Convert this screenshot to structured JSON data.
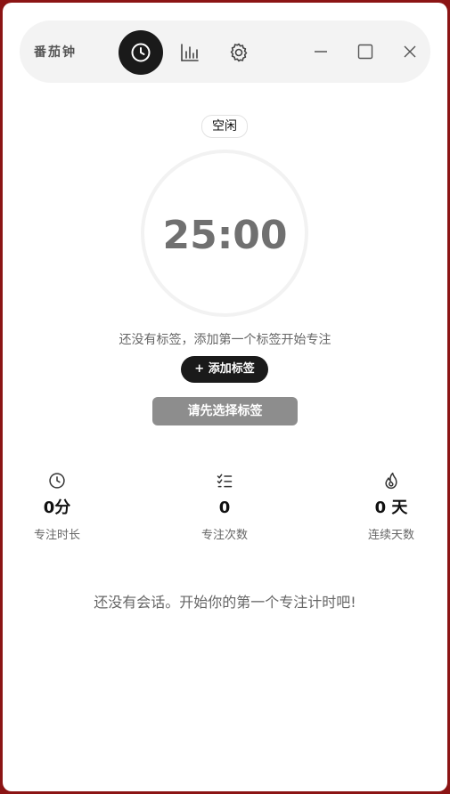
{
  "app": {
    "title": "番茄钟"
  },
  "nav": [
    {
      "name": "timer",
      "icon": "clock-icon",
      "active": true
    },
    {
      "name": "stats",
      "icon": "bar-chart-icon",
      "active": false
    },
    {
      "name": "settings",
      "icon": "gear-icon",
      "active": false
    }
  ],
  "window_controls": [
    "minimize-icon",
    "maximize-icon",
    "close-icon"
  ],
  "timer": {
    "status": "空闲",
    "time": "25:00"
  },
  "tags": {
    "hint": "还没有标签，添加第一个标签开始专注",
    "add_label": "+ 添加标签"
  },
  "start_button": {
    "label": "请先选择标签"
  },
  "stats": [
    {
      "icon": "clock-icon",
      "value": "0分",
      "label": "专注时长"
    },
    {
      "icon": "checklist-icon",
      "value": "0",
      "label": "专注次数"
    },
    {
      "icon": "flame-icon",
      "value": "0 天",
      "label": "连续天数"
    }
  ],
  "sessions": {
    "empty_text": "还没有会话。开始你的第一个专注计时吧!"
  },
  "colors": {
    "background": "#8b1414",
    "accent": "#1a1a1a",
    "disabled_button": "#8d8d8d"
  }
}
